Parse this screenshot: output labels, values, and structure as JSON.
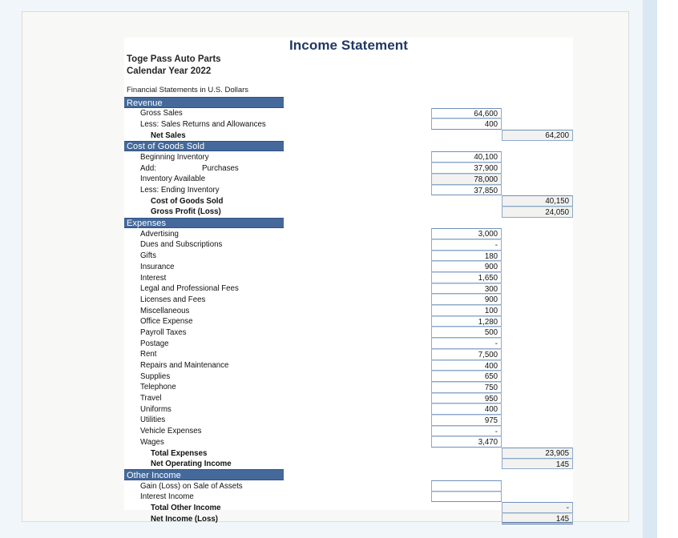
{
  "document": {
    "title": "Income Statement",
    "company_name": "Toge Pass Auto Parts",
    "period": "Calendar Year 2022",
    "currency_note": "Financial Statements in U.S. Dollars"
  },
  "colors": {
    "section_header_bg": "#44699a",
    "section_header_text": "#ffffff",
    "title_text": "#1f3864",
    "cell_border": "#8ea9c9",
    "total_cell_bg": "#f2f2f0",
    "page_bg": "#f1f6fa",
    "card_bg": "#f8f8f7",
    "sheet_bg": "#ffffff",
    "scrollbar_track": "#d9e8f3"
  },
  "sections": [
    {
      "header": "Revenue",
      "rows": [
        {
          "label": "Gross Sales",
          "indent": 1,
          "col1": "64,600",
          "col2": ""
        },
        {
          "label": "Less: Sales Returns and Allowances",
          "indent": 1,
          "col1": "400",
          "col2": ""
        },
        {
          "label": "Net Sales",
          "indent": 2,
          "col1": "",
          "col2": "64,200"
        }
      ]
    },
    {
      "header": "Cost of Goods Sold",
      "rows": [
        {
          "label": "Beginning Inventory",
          "indent": 1,
          "col1": "40,100",
          "col2": ""
        },
        {
          "label": "Add:",
          "sublabel": "Purchases",
          "indent": 1,
          "col1": "37,900",
          "col2": ""
        },
        {
          "label": "Inventory Available",
          "indent": 1,
          "col1": "78,000",
          "col2": "",
          "col1_shaded": true
        },
        {
          "label": "Less: Ending Inventory",
          "indent": 1,
          "col1": "37,850",
          "col2": ""
        },
        {
          "label": "Cost of Goods Sold",
          "indent": 2,
          "col1": "",
          "col2": "40,150"
        },
        {
          "label": "Gross Profit (Loss)",
          "indent": 2,
          "col1": "",
          "col2": "24,050"
        }
      ]
    },
    {
      "header": "Expenses",
      "rows": [
        {
          "label": "Advertising",
          "indent": 1,
          "col1": "3,000",
          "col2": ""
        },
        {
          "label": "Dues and Subscriptions",
          "indent": 1,
          "col1": "-",
          "col2": ""
        },
        {
          "label": "Gifts",
          "indent": 1,
          "col1": "180",
          "col2": ""
        },
        {
          "label": "Insurance",
          "indent": 1,
          "col1": "900",
          "col2": ""
        },
        {
          "label": "Interest",
          "indent": 1,
          "col1": "1,650",
          "col2": ""
        },
        {
          "label": "Legal and Professional Fees",
          "indent": 1,
          "col1": "300",
          "col2": ""
        },
        {
          "label": "Licenses and Fees",
          "indent": 1,
          "col1": "900",
          "col2": ""
        },
        {
          "label": "Miscellaneous",
          "indent": 1,
          "col1": "100",
          "col2": ""
        },
        {
          "label": "Office Expense",
          "indent": 1,
          "col1": "1,280",
          "col2": ""
        },
        {
          "label": "Payroll Taxes",
          "indent": 1,
          "col1": "500",
          "col2": ""
        },
        {
          "label": "Postage",
          "indent": 1,
          "col1": "-",
          "col2": ""
        },
        {
          "label": "Rent",
          "indent": 1,
          "col1": "7,500",
          "col2": ""
        },
        {
          "label": "Repairs and Maintenance",
          "indent": 1,
          "col1": "400",
          "col2": ""
        },
        {
          "label": "Supplies",
          "indent": 1,
          "col1": "650",
          "col2": ""
        },
        {
          "label": "Telephone",
          "indent": 1,
          "col1": "750",
          "col2": ""
        },
        {
          "label": "Travel",
          "indent": 1,
          "col1": "950",
          "col2": ""
        },
        {
          "label": "Uniforms",
          "indent": 1,
          "col1": "400",
          "col2": ""
        },
        {
          "label": "Utilities",
          "indent": 1,
          "col1": "975",
          "col2": ""
        },
        {
          "label": "Vehicle Expenses",
          "indent": 1,
          "col1": "-",
          "col2": ""
        },
        {
          "label": "Wages",
          "indent": 1,
          "col1": "3,470",
          "col2": ""
        },
        {
          "label": "Total Expenses",
          "indent": 2,
          "col1": "",
          "col2": "23,905"
        },
        {
          "label": "Net Operating Income",
          "indent": 2,
          "col1": "",
          "col2": "145"
        }
      ]
    },
    {
      "header": "Other Income",
      "rows": [
        {
          "label": "Gain (Loss) on Sale of Assets",
          "indent": 1,
          "col1": "",
          "col2": "",
          "col1_blank": true
        },
        {
          "label": "Interest Income",
          "indent": 1,
          "col1": "",
          "col2": "",
          "col1_blank": true
        },
        {
          "label": "Total Other Income",
          "indent": 2,
          "col1": "",
          "col2": "-"
        },
        {
          "label": "Net Income (Loss)",
          "indent": 2,
          "col1": "",
          "col2": "145",
          "grand_total": true
        }
      ]
    }
  ]
}
